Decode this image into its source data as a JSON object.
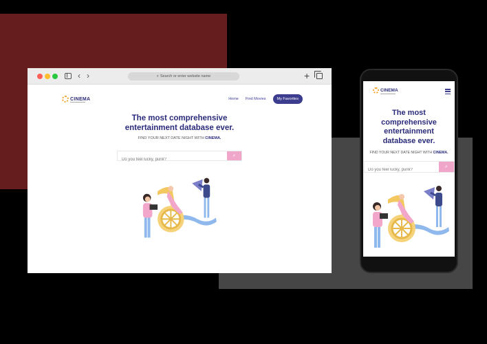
{
  "colors": {
    "brand": "#2b2b7c",
    "accent_pink": "#f0a6c8",
    "logo_orange": "#f3a32a",
    "nav_active": "#3d3d8f",
    "bg_red": "#651d1d",
    "bg_gray": "#464646"
  },
  "browser": {
    "address_placeholder": "Search or enter website name",
    "nav_back_icon": "‹",
    "nav_forward_icon": "›",
    "new_tab_icon": "+"
  },
  "site": {
    "logo": "CINEMA",
    "nav": [
      "Home",
      "Find Movies",
      "My Favorites"
    ],
    "title_line1": "The most comprehensive",
    "title_line2": "entertainment database ever.",
    "subtitle_prefix": "FIND YOUR NEXT DATE NIGHT WITH",
    "subtitle_brand": "CINEMA.",
    "search_placeholder": "Do you feel lucky, punk?",
    "search_icon": "⌕"
  },
  "mobile": {
    "logo": "CINEMA",
    "title_line1": "The most",
    "title_line2": "comprehensive",
    "title_line3": "entertainment",
    "title_line4": "database ever.",
    "subtitle_prefix": "FIND YOUR NEXT DATE NIGHT WITH",
    "subtitle_brand": "CINEMA.",
    "search_placeholder": "Do you feel lucky, punk?"
  }
}
